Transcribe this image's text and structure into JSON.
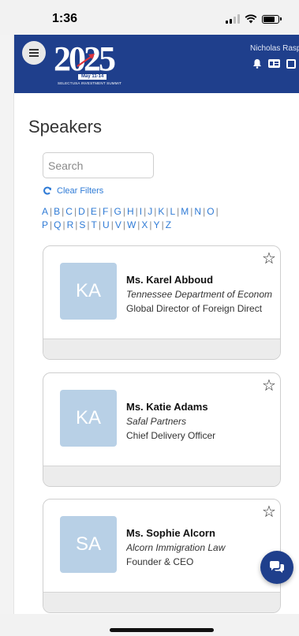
{
  "status_bar": {
    "time": "1:36",
    "signal_icon": "cellular-signal-icon",
    "wifi_icon": "wifi-icon",
    "battery_icon": "battery-icon"
  },
  "header": {
    "background_color": "#1f3f8c",
    "menu_icon": "hamburger-icon",
    "logo": {
      "year": "2025",
      "dates": "May 11-14",
      "subtitle": "SELECTUSA INVESTMENT SUMMIT"
    },
    "user_name": "Nicholas Rasp",
    "icons": [
      "bell-icon",
      "id-card-icon",
      "copy-icon"
    ]
  },
  "page": {
    "title": "Speakers",
    "search": {
      "placeholder": "Search",
      "value": ""
    },
    "clear_filters_label": "Clear Filters",
    "alphabet_row1": [
      "A",
      "B",
      "C",
      "D",
      "E",
      "F",
      "G",
      "H",
      "I",
      "J",
      "K",
      "L",
      "M",
      "N",
      "O"
    ],
    "alphabet_row2": [
      "P",
      "Q",
      "R",
      "S",
      "T",
      "U",
      "V",
      "W",
      "X",
      "Y",
      "Z"
    ]
  },
  "speakers": [
    {
      "initials": "KA",
      "name": "Ms. Karel Abboud",
      "organization": "Tennessee Department of Econom",
      "title": "Global Director of Foreign Direct"
    },
    {
      "initials": "KA",
      "name": "Ms. Katie Adams",
      "organization": "Safal Partners",
      "title": "Chief Delivery Officer"
    },
    {
      "initials": "SA",
      "name": "Ms. Sophie Alcorn",
      "organization": "Alcorn Immigration Law",
      "title": "Founder & CEO"
    }
  ],
  "chat_fab_icon": "chat-bubbles-icon",
  "colors": {
    "accent": "#2f7bd6",
    "avatar": "#b8d0e6"
  }
}
